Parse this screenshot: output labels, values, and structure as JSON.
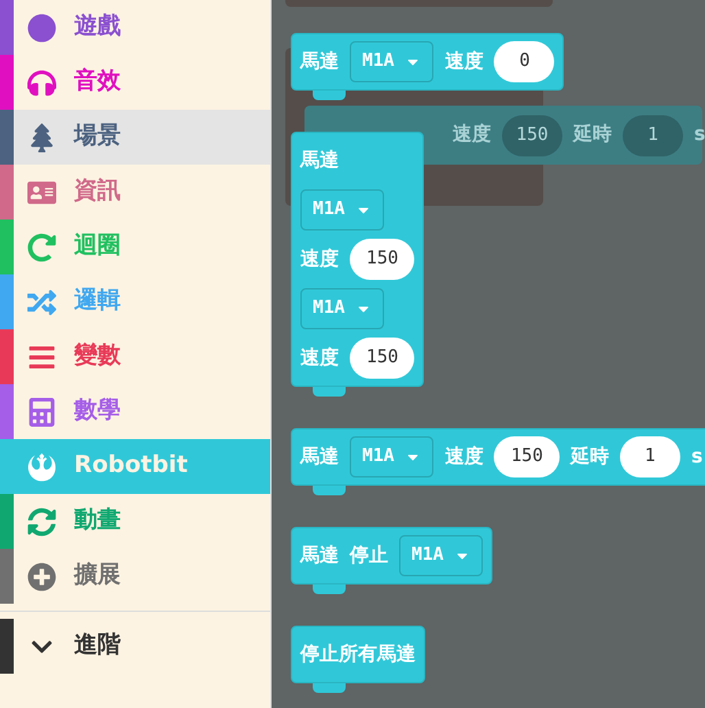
{
  "sidebar": {
    "items": [
      {
        "label": "遊戲",
        "color": "#8a50d0",
        "selected": false,
        "hovered": false
      },
      {
        "label": "音效",
        "color": "#e010c0",
        "selected": false,
        "hovered": false
      },
      {
        "label": "場景",
        "color": "#4c6280",
        "selected": false,
        "hovered": true
      },
      {
        "label": "資訊",
        "color": "#d0698a",
        "selected": false,
        "hovered": false
      },
      {
        "label": "迴圈",
        "color": "#20c060",
        "selected": false,
        "hovered": false
      },
      {
        "label": "邏輯",
        "color": "#40a8f0",
        "selected": false,
        "hovered": false
      },
      {
        "label": "變數",
        "color": "#e83a58",
        "selected": false,
        "hovered": false
      },
      {
        "label": "數學",
        "color": "#a55ee8",
        "selected": false,
        "hovered": false
      },
      {
        "label": "Robotbit",
        "color": "#30c8d8",
        "selected": true,
        "hovered": false
      },
      {
        "label": "動畫",
        "color": "#10a870",
        "selected": false,
        "hovered": false
      },
      {
        "label": "擴展",
        "color": "#707070",
        "selected": false,
        "hovered": false
      }
    ],
    "advanced": {
      "label": "進階",
      "color": "#333333"
    }
  },
  "ghost_block": {
    "parts": [
      {
        "kind": "label",
        "text": "速度"
      },
      {
        "kind": "number",
        "text": "150"
      },
      {
        "kind": "label",
        "text": "延時"
      },
      {
        "kind": "number",
        "text": "1"
      },
      {
        "kind": "label",
        "text": "s"
      }
    ]
  },
  "blocks": [
    {
      "rows": [
        [
          {
            "kind": "label",
            "text": "馬達"
          },
          {
            "kind": "dropdown",
            "text": "M1A"
          },
          {
            "kind": "label",
            "text": "速度"
          },
          {
            "kind": "number",
            "text": "0"
          }
        ]
      ]
    },
    {
      "rows": [
        [
          {
            "kind": "label",
            "text": "馬達"
          }
        ],
        [
          {
            "kind": "dropdown",
            "text": "M1A"
          }
        ],
        [
          {
            "kind": "label",
            "text": "速度"
          },
          {
            "kind": "number",
            "text": "150"
          }
        ],
        [
          {
            "kind": "dropdown",
            "text": "M1A"
          }
        ],
        [
          {
            "kind": "label",
            "text": "速度"
          },
          {
            "kind": "number",
            "text": "150"
          }
        ]
      ]
    },
    {
      "rows": [
        [
          {
            "kind": "label",
            "text": "馬達"
          },
          {
            "kind": "dropdown",
            "text": "M1A"
          },
          {
            "kind": "label",
            "text": "速度"
          },
          {
            "kind": "number",
            "text": "150"
          },
          {
            "kind": "label",
            "text": "延時"
          },
          {
            "kind": "number",
            "text": "1"
          },
          {
            "kind": "label",
            "text": "s"
          }
        ]
      ]
    },
    {
      "rows": [
        [
          {
            "kind": "label",
            "text": "馬達"
          },
          {
            "kind": "label",
            "text": "停止"
          },
          {
            "kind": "dropdown",
            "text": "M1A"
          }
        ]
      ]
    },
    {
      "rows": [
        [
          {
            "kind": "label",
            "text": "停止所有馬達"
          }
        ]
      ]
    }
  ]
}
